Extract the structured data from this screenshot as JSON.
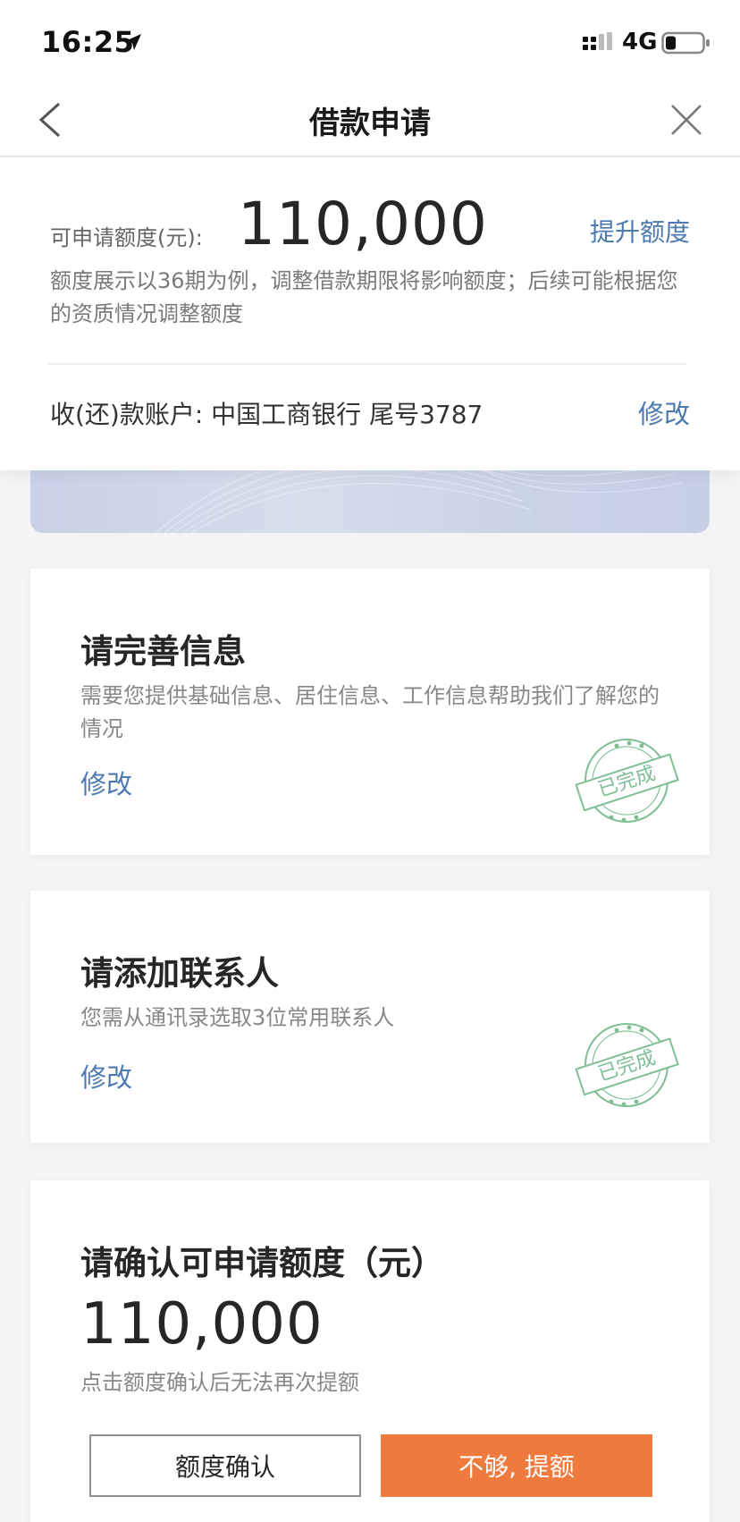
{
  "status_bar": {
    "time": "16:25",
    "network": "4G"
  },
  "nav": {
    "title": "借款申请"
  },
  "limit_panel": {
    "label": "可申请额度(元):",
    "amount": "110,000",
    "raise_link": "提升额度",
    "note": "额度展示以36期为例，调整借款期限将影响额度；后续可能根据您的资质情况调整额度",
    "account_text": "收(还)款账户: 中国工商银行 尾号3787",
    "account_edit": "修改"
  },
  "cards": {
    "info": {
      "title": "请完善信息",
      "desc": "需要您提供基础信息、居住信息、工作信息帮助我们了解您的情况",
      "link": "修改",
      "stamp": "已完成"
    },
    "contacts": {
      "title": "请添加联系人",
      "desc": "您需从通讯录选取3位常用联系人",
      "link": "修改",
      "stamp": "已完成"
    },
    "confirm": {
      "title": "请确认可申请额度（元）",
      "amount": "110,000",
      "note": "点击额度确认后无法再次提额",
      "confirm_button": "额度确认",
      "raise_button": "不够, 提额"
    }
  },
  "colors": {
    "accent_blue": "#4c79b1",
    "primary_orange": "#ef7a3d",
    "stamp_green": "#7fbf95"
  },
  "icons": [
    "location-arrow-icon",
    "signal-icon",
    "battery-icon",
    "back-chevron-icon",
    "close-icon",
    "completed-stamp-icon"
  ]
}
